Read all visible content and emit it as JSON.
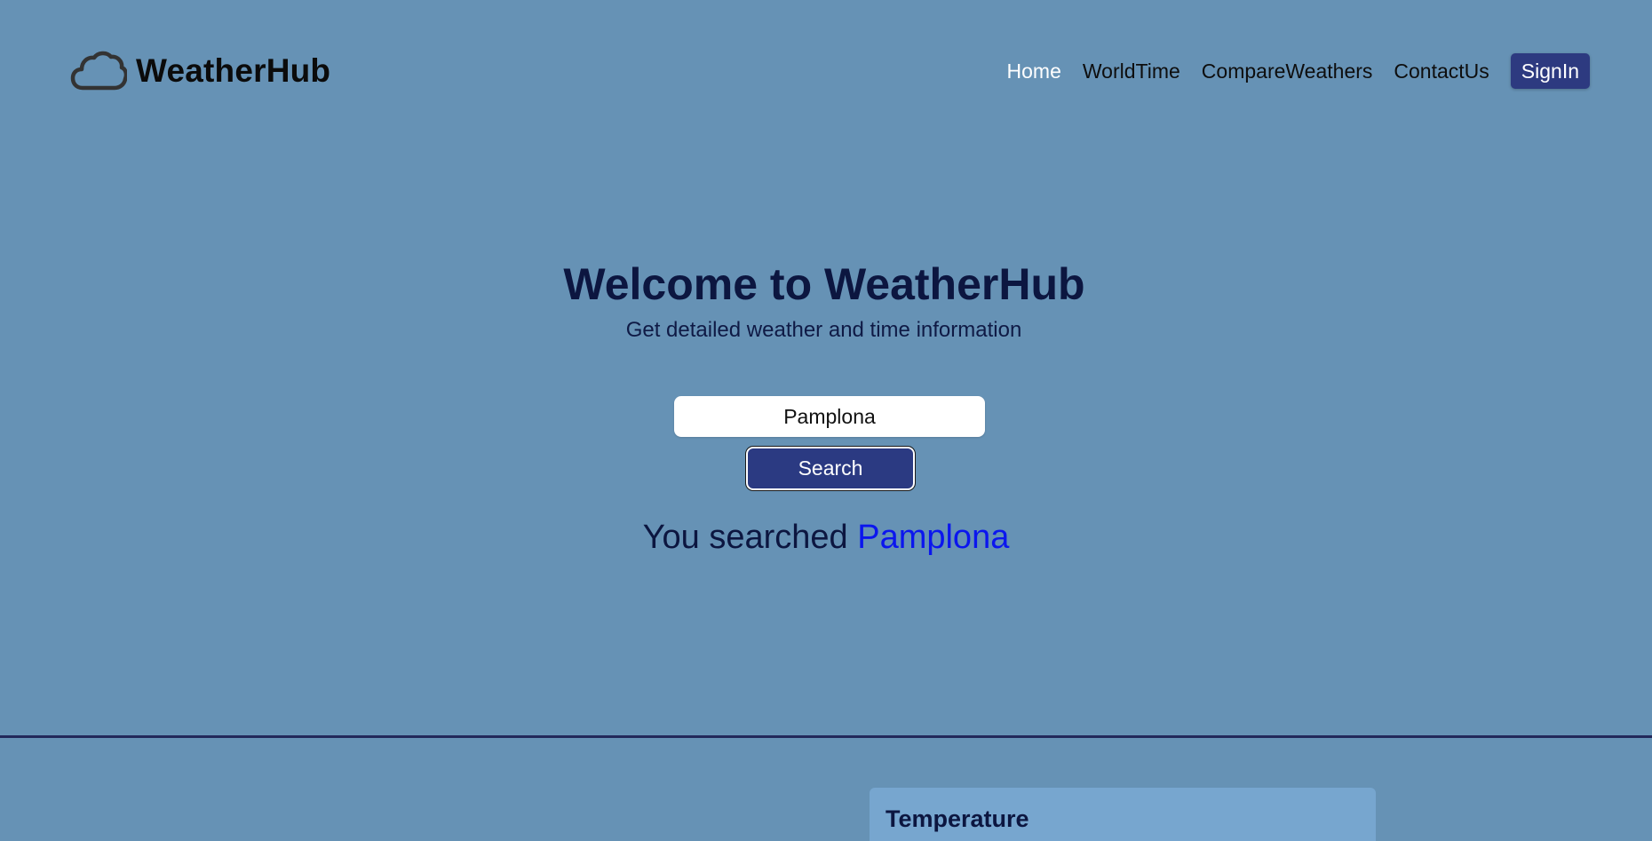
{
  "brand": {
    "name": "WeatherHub",
    "icon": "cloud-icon"
  },
  "nav": {
    "items": [
      {
        "label": "Home",
        "active": true
      },
      {
        "label": "WorldTime",
        "active": false
      },
      {
        "label": "CompareWeathers",
        "active": false
      },
      {
        "label": "ContactUs",
        "active": false
      }
    ],
    "signin_label": "SignIn"
  },
  "hero": {
    "title": "Welcome to WeatherHub",
    "subtitle": "Get detailed weather and time information"
  },
  "search": {
    "value": "Pamplona",
    "button_label": "Search",
    "result_prefix": "You searched",
    "result_city": "Pamplona"
  },
  "cards": {
    "temperature_title": "Temperature"
  },
  "colors": {
    "background": "#6692b5",
    "accent": "#2b3a82",
    "heading": "#0c1640",
    "link_highlight": "#0b16ee",
    "card": "#77a6cf"
  }
}
